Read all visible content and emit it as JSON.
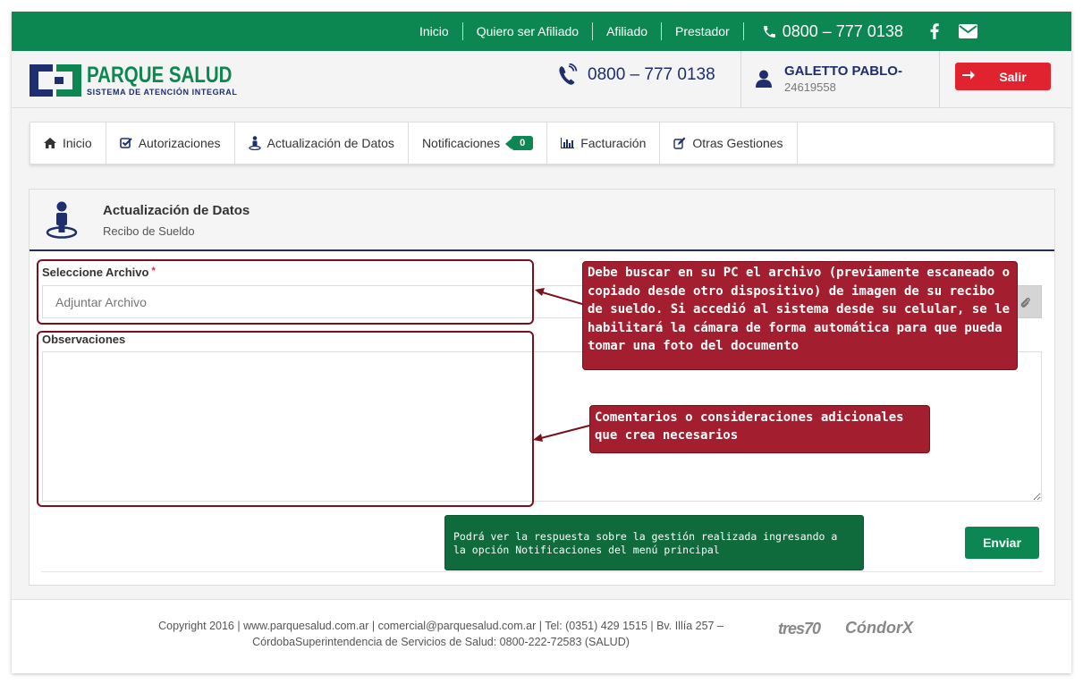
{
  "topbar": {
    "nav": [
      "Inicio",
      "Quiero ser Afiliado",
      "Afiliado",
      "Prestador"
    ],
    "phone": "0800 – 777 0138"
  },
  "header": {
    "logo_title": "PARQUE SALUD",
    "logo_subtitle": "SISTEMA DE ATENCIÓN INTEGRAL",
    "phone": "0800 – 777 0138",
    "user_name": "GALETTO PABLO-",
    "user_id": "24619558",
    "logout_label": "Salir"
  },
  "menu": {
    "items": [
      {
        "label": "Inicio",
        "icon": "home-icon"
      },
      {
        "label": "Autorizaciones",
        "icon": "check-square-icon"
      },
      {
        "label": "Actualización de Datos",
        "icon": "person-pin-icon"
      },
      {
        "label": "Notificaciones",
        "icon": "",
        "badge": "0"
      },
      {
        "label": "Facturación",
        "icon": "bar-chart-icon"
      },
      {
        "label": "Otras Gestiones",
        "icon": "edit-icon"
      }
    ]
  },
  "panel": {
    "title": "Actualización de Datos",
    "subtitle": "Recibo de Sueldo"
  },
  "form": {
    "file_label": "Seleccione Archivo",
    "required_mark": "*",
    "file_placeholder": "Adjuntar Archivo",
    "obs_label": "Observaciones",
    "submit_label": "Enviar"
  },
  "annotations": {
    "callout1": "Debe buscar en su PC el archivo (previamente escaneado o copiado desde otro dispositivo) de imagen de su recibo de sueldo. Si accedió al sistema desde su celular, se le habilitará la cámara de forma automática para que pueda tomar una foto del documento",
    "callout2": "Comentarios o consideraciones adicionales que crea necesarios",
    "tip": "Podrá ver la respuesta sobre la gestión realizada ingresando a la opción Notificaciones del menú principal"
  },
  "footer": {
    "copyright_line1": "Copyright 2016 | www.parquesalud.com.ar | comercial@parquesalud.com.ar | Tel: (0351) 429 1515 | Bv. Illía 257 –",
    "copyright_line2": "CórdobaSuperintendencia de Servicios de Salud: 0800-222-72583 (SALUD)",
    "brand1": "tres70",
    "brand2": "CóndorX"
  },
  "colors": {
    "brand_green": "#0d8751",
    "brand_navy": "#1e2e6e",
    "danger_red": "#e12330",
    "callout_red": "#a31e2f",
    "tip_green": "#0f6b3c"
  }
}
